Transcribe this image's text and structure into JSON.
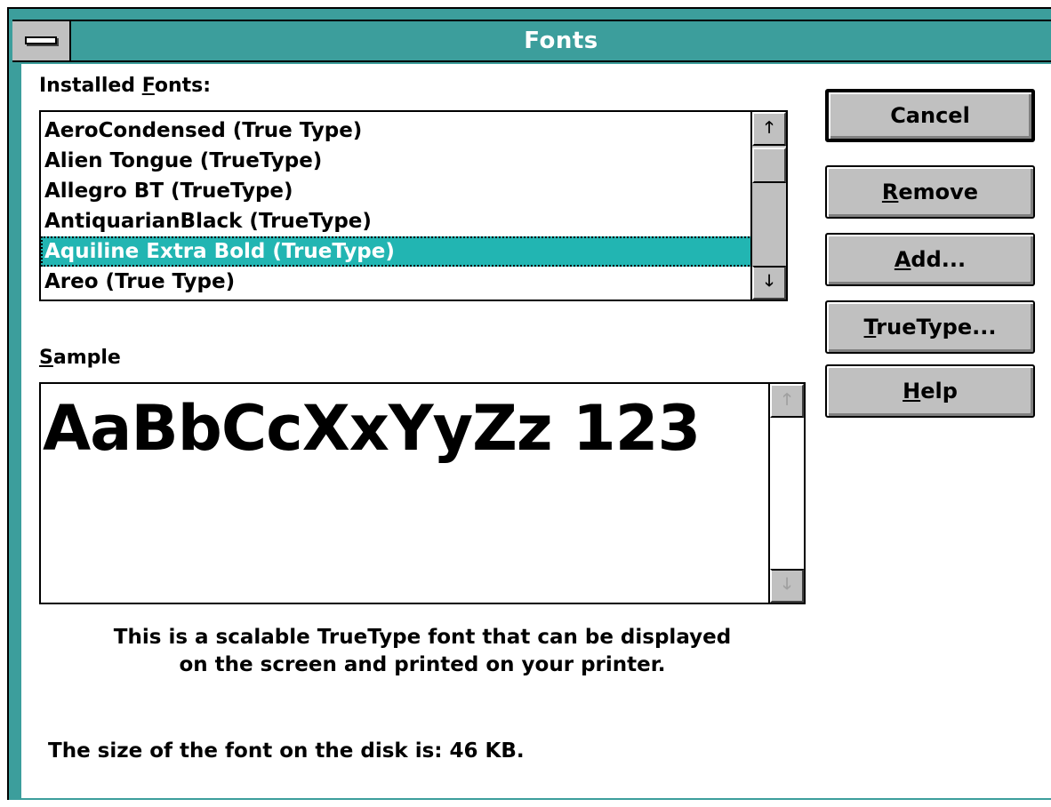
{
  "window": {
    "title": "Fonts",
    "accent_color": "#3c9e9c",
    "selection_color": "#22b5b2"
  },
  "installed_fonts": {
    "label_before": "Installed ",
    "label_mnemonic": "F",
    "label_after": "onts:",
    "items": [
      "AeroCondensed (True Type)",
      "Alien Tongue (TrueType)",
      "Allegro BT (TrueType)",
      "AntiquarianBlack (TrueType)",
      "Aquiline Extra Bold (TrueType)",
      "Areo (True Type)"
    ],
    "selected": "Aquiline Extra Bold (TrueType)"
  },
  "sample": {
    "label_mnemonic": "S",
    "label_after": "ample",
    "text": "AaBbCcXxYyZz 123"
  },
  "description": {
    "line1": "This is a scalable TrueType font that can be displayed",
    "line2": "on the screen and printed on your printer.",
    "size_line": "The size of the font on the disk is:  46 KB."
  },
  "buttons": {
    "cancel": "Cancel",
    "remove_mnemonic": "R",
    "remove_after": "emove",
    "add_mnemonic": "A",
    "add_after": "dd...",
    "truetype_mnemonic": "T",
    "truetype_after": "rueType...",
    "help_mnemonic": "H",
    "help_after": "elp"
  },
  "icons": {
    "system_menu": "system-menu-icon",
    "scroll_up": "arrow-up-icon",
    "scroll_down": "arrow-down-icon"
  }
}
